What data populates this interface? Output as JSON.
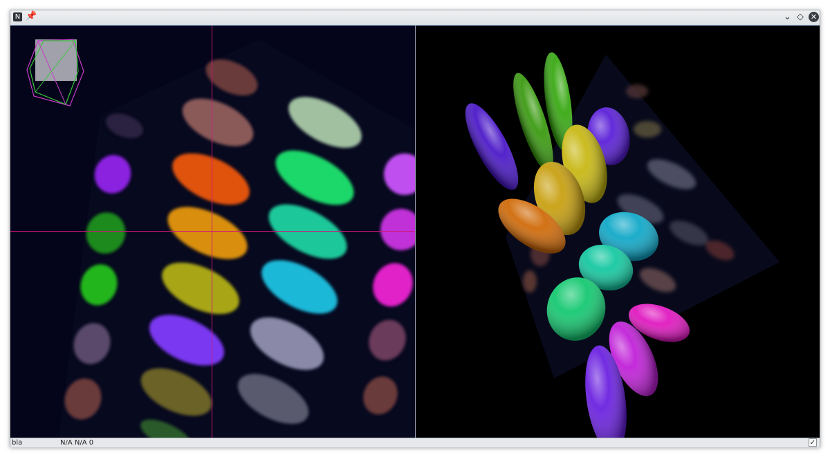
{
  "titlebar": {
    "app_icon": "bigdataviewer-icon",
    "pin_icon": "pin-icon",
    "minimize_symbol": "⌄",
    "maximize_symbol": "◇",
    "close_symbol": "✕"
  },
  "left_view": {
    "background": "#04051a",
    "crosshair_color": "#d0157a",
    "orientation_overlay": "bounding-box-icon"
  },
  "right_view": {
    "background": "#000000",
    "content": "3d-surface-render"
  },
  "statusbar": {
    "source_name": "bla",
    "coordinates": "N/A N/A 0",
    "check_icon": "checkmark-icon",
    "check_symbol": "✓"
  }
}
